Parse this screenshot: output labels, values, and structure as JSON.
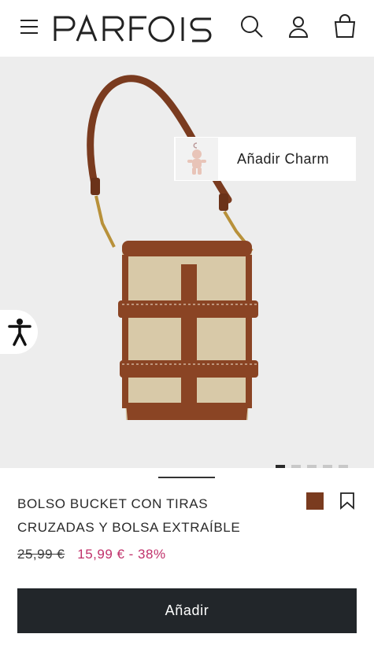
{
  "header": {
    "brand": "PARFOIS",
    "icons": [
      "menu-icon",
      "search-icon",
      "user-icon",
      "bag-icon"
    ]
  },
  "hero": {
    "charm_label": "Añadir Charm",
    "carousel": {
      "total": 5,
      "active": 1
    }
  },
  "product": {
    "title": "BOLSO BUCKET CON TIRAS CRUZADAS Y BOLSA EXTRAÍBLE",
    "old_price": "25,99 €",
    "new_price": "15,99 € - 38%",
    "color_swatch": "#7a3b1f"
  },
  "actions": {
    "add_label": "Añadir"
  },
  "colors": {
    "accent_price": "#c0306a",
    "button_bg": "#22262a"
  }
}
